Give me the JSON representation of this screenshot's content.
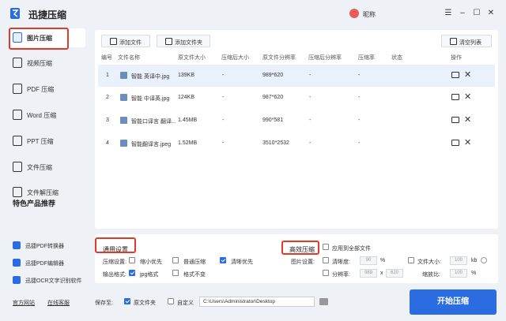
{
  "app": {
    "title": "迅捷压缩",
    "nickname": "昵称",
    "brand_color": "#2b6de0",
    "highlight_color": "#e03a2a"
  },
  "window_controls": [
    "menu-icon",
    "minimize-icon",
    "maximize-icon",
    "close-icon"
  ],
  "sidebar": {
    "items": [
      {
        "label": "图片压缩",
        "icon": "image-icon",
        "active": true
      },
      {
        "label": "视频压缩",
        "icon": "video-icon"
      },
      {
        "label": "PDF 压缩",
        "icon": "pdf-icon"
      },
      {
        "label": "Word 压缩",
        "icon": "word-icon"
      },
      {
        "label": "PPT 压缩",
        "icon": "ppt-icon"
      },
      {
        "label": "文件压缩",
        "icon": "file-icon"
      },
      {
        "label": "文件解压缩",
        "icon": "unzip-icon"
      }
    ],
    "featured_title": "特色产品推荐",
    "featured": [
      "迅捷PDF转换器",
      "迅捷PDF编辑器",
      "迅捷OCR文字识别软件"
    ],
    "footer_links": [
      "官方网站",
      "在线客服"
    ]
  },
  "toolbar": {
    "add_file": "添加文件",
    "add_folder": "添加文件夹",
    "clear_list": "清空列表"
  },
  "table": {
    "headers": [
      "编号",
      "文件名称",
      "原文件大小",
      "压缩后大小",
      "原文件分辨率",
      "压缩后分辨率",
      "压缩率",
      "状态",
      "操作"
    ],
    "rows": [
      {
        "no": "1",
        "name": "智能 英译中.jpg",
        "size": "139KB",
        "after_size": "-",
        "res": "989*620",
        "after_res": "-",
        "rate": "-",
        "selected": true
      },
      {
        "no": "2",
        "name": "智能 中译英.jpg",
        "size": "124KB",
        "after_size": "-",
        "res": "987*620",
        "after_res": "-",
        "rate": "-"
      },
      {
        "no": "3",
        "name": "智能口译言 翻译...",
        "size": "1.45MB",
        "after_size": "-",
        "res": "990*581",
        "after_res": "-",
        "rate": "-"
      },
      {
        "no": "4",
        "name": "智能翻译言.jpeg",
        "size": "1.52MB",
        "after_size": "-",
        "res": "3510*2532",
        "after_res": "-",
        "rate": "-"
      }
    ]
  },
  "general_settings": {
    "title": "通用设置",
    "compress_label": "压缩设置:",
    "options": [
      {
        "label": "缩小优先",
        "checked": false
      },
      {
        "label": "普通压缩",
        "checked": false
      },
      {
        "label": "清晰优先",
        "checked": true
      }
    ],
    "output_label": "输出格式:",
    "formats": [
      {
        "label": "jpg格式",
        "checked": true
      },
      {
        "label": "格式不变",
        "checked": false
      }
    ]
  },
  "efficient": {
    "title": "高效压缩",
    "apply_all": "应用到全部文件",
    "image_settings_label": "图片设置:",
    "sharpness_label": "清晰度:",
    "sharpness_value": "90",
    "sharpness_unit": "%",
    "resolution_label": "分辨率:",
    "res_w": "989",
    "res_x": "x",
    "res_h": "620",
    "file_size_label": "文件大小:",
    "file_size_value": "100",
    "file_size_unit": "kb",
    "scale_label": "缩放比:",
    "scale_value": "100",
    "scale_unit": "%"
  },
  "bottom": {
    "save_to": "保存至:",
    "original_folder": "原文件夹",
    "custom": "自定义",
    "path": "C:\\Users\\Administrator\\Desktop",
    "start": "开始压缩"
  }
}
